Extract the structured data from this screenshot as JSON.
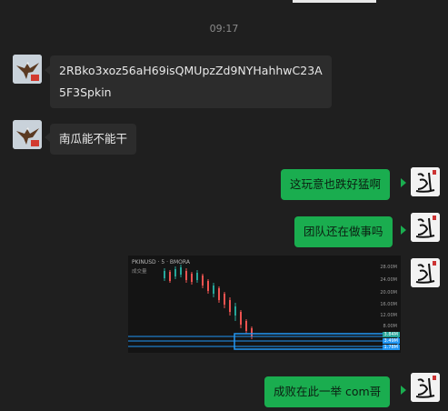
{
  "chat": {
    "timestamp": "09:17",
    "messages": [
      {
        "side": "in",
        "text": "2RBko3xoz56aH69isQMUpzZd9NYHahhwC23A5F3Spkin",
        "avatar": "eagle-avatar"
      },
      {
        "side": "in",
        "text": "南瓜能不能干",
        "avatar": "eagle-avatar"
      },
      {
        "side": "out",
        "text": "这玩意也跌好猛啊",
        "avatar": "calligraphy-avatar"
      },
      {
        "side": "out",
        "text": "团队还在做事吗",
        "avatar": "calligraphy-avatar"
      },
      {
        "side": "out",
        "type": "image",
        "avatar": "calligraphy-avatar"
      },
      {
        "side": "out",
        "text": "成败在此一举 com哥",
        "avatar": "calligraphy-avatar"
      }
    ]
  },
  "chart_image": {
    "header": "PKINUSD · 5 · BMORA",
    "sub": "成交量",
    "axis_labels": [
      "28.00M",
      "24.00M",
      "20.00M",
      "16.00M",
      "12.00M",
      "8.00M"
    ],
    "price_tags": [
      "3.84M",
      "3.49M",
      "1.78M"
    ],
    "colors": {
      "up": "#26a69a",
      "down": "#ef5350",
      "box": "#2196f3"
    }
  }
}
